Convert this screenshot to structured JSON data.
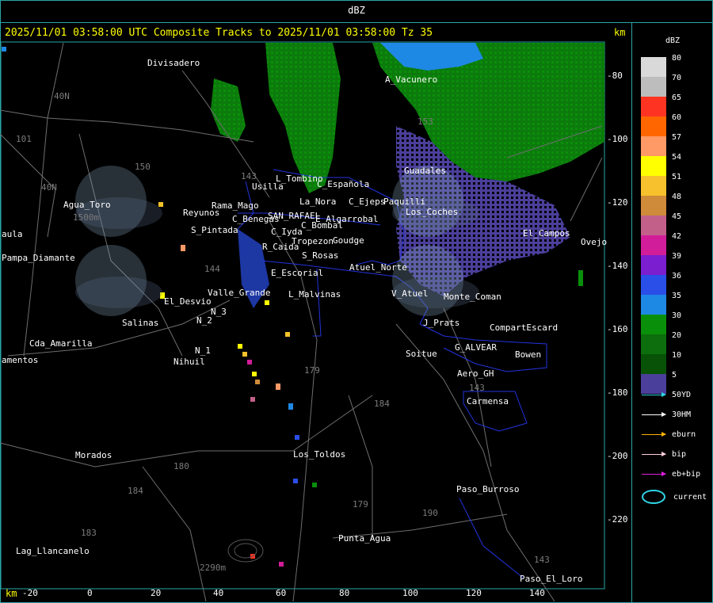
{
  "window": {
    "title": "dBZ"
  },
  "header": {
    "text": "2025/11/01 03:58:00 UTC Composite Tracks to 2025/11/01 03:58:00 Tz 35",
    "km_top": "km",
    "km_bottom": "km"
  },
  "legend": {
    "title": "dBZ",
    "levels": [
      {
        "label": "80",
        "color": "#d9d9d9"
      },
      {
        "label": "70",
        "color": "#bdbdbd"
      },
      {
        "label": "65",
        "color": "#ff3322"
      },
      {
        "label": "60",
        "color": "#ff6600"
      },
      {
        "label": "57",
        "color": "#ff9966"
      },
      {
        "label": "54",
        "color": "#ffff00"
      },
      {
        "label": "51",
        "color": "#f6c12c"
      },
      {
        "label": "48",
        "color": "#cf8a3a"
      },
      {
        "label": "45",
        "color": "#c2608a"
      },
      {
        "label": "42",
        "color": "#d21d9a"
      },
      {
        "label": "39",
        "color": "#7a1ecf"
      },
      {
        "label": "36",
        "color": "#2a4ee8"
      },
      {
        "label": "35",
        "color": "#1e88e5"
      },
      {
        "label": "30",
        "color": "#0a8f0a"
      },
      {
        "label": "20",
        "color": "#0c6e0c"
      },
      {
        "label": "10",
        "color": "#075207"
      },
      {
        "label": "5",
        "color": "#4a3f9a"
      }
    ],
    "tracks": [
      {
        "label": "50YD",
        "color": "#2fd4e6"
      },
      {
        "label": "30HM",
        "color": "#ffffff"
      },
      {
        "label": "eburn",
        "color": "#ffb300"
      },
      {
        "label": "bip",
        "color": "#ffd0e0"
      },
      {
        "label": "eb+bip",
        "color": "#e020e0"
      },
      {
        "label": "current",
        "color": "#2fd4e6"
      }
    ]
  },
  "axes": {
    "y_ticks": [
      "-80",
      "-100",
      "-120",
      "-140",
      "-160",
      "-180",
      "-200",
      "-220"
    ],
    "x_ticks": [
      "-20",
      "0",
      "20",
      "40",
      "60",
      "80",
      "100",
      "120",
      "140"
    ]
  },
  "places": [
    "Divisadero",
    "A_Vacunero",
    "Guadales",
    "L_Tombino",
    "Usilla",
    "C_Española",
    "C_Ejeps",
    "Paquilli",
    "La_Nora",
    "Agua_Toro",
    "Reyunos",
    "Rama_Mago",
    "C_Benegas",
    "SAN_RAFAEL",
    "C_Bombal",
    "E_Algarrobal",
    "S_Pintada",
    "C_Iyda",
    "Tropezon",
    "Goudge",
    "R_Caida",
    "S_Rosas",
    "Atuel_Norte",
    "E_Escorial",
    "Valle_Grande",
    "L_Malvinas",
    "V_Atuel",
    "El_Desvio",
    "N_3",
    "N_2",
    "Salinas",
    "J_Prats",
    "CompartEscard",
    "Cda_Amarilla",
    "N_1",
    "Nihuil",
    "G_ALVEAR",
    "Bowen",
    "Soitue",
    "Aero_GH",
    "Carmensa",
    "Los_Toldos",
    "Morados",
    "Paso_Burroso",
    "Punta_Agua",
    "Lag_Llancanelo",
    "Paso_El_Loro",
    "Pampa_Diamante",
    "aula",
    "amentos",
    "Ovejo",
    "El_Campos",
    "Los_Coches",
    "Monte_Coman"
  ],
  "roads": [
    "40N",
    "101",
    "150",
    "143",
    "144",
    "153",
    "40N",
    "179",
    "184",
    "180",
    "184",
    "183",
    "179",
    "190",
    "143",
    "143",
    "2290m",
    "1500m"
  ]
}
